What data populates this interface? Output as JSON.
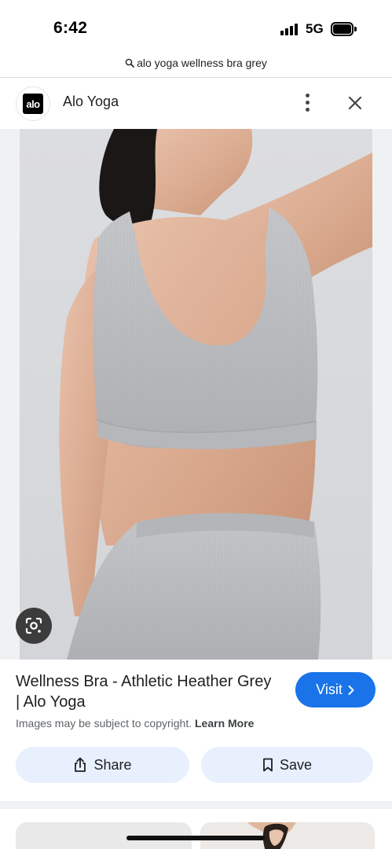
{
  "status_bar": {
    "time": "6:42",
    "network": "5G"
  },
  "url_bar": {
    "query": "alo yoga wellness bra grey"
  },
  "source": {
    "logo_text": "alo",
    "name": "Alo Yoga"
  },
  "result": {
    "title": "Wellness Bra - Athletic Heather Grey | Alo Yoga",
    "visit_label": "Visit",
    "copyright_text": "Images may be subject to copyright.",
    "learn_more_label": "Learn More",
    "share_label": "Share",
    "save_label": "Save"
  },
  "icons": {
    "search": "search-icon",
    "more": "more-vert-icon",
    "close": "close-icon",
    "lens": "google-lens-icon",
    "chevron": "chevron-right-icon",
    "share": "share-icon",
    "bookmark": "bookmark-icon"
  },
  "colors": {
    "accent": "#1a73e8",
    "chip_bg": "#e8f0fe",
    "garment_grey": "#b9bbbe"
  }
}
